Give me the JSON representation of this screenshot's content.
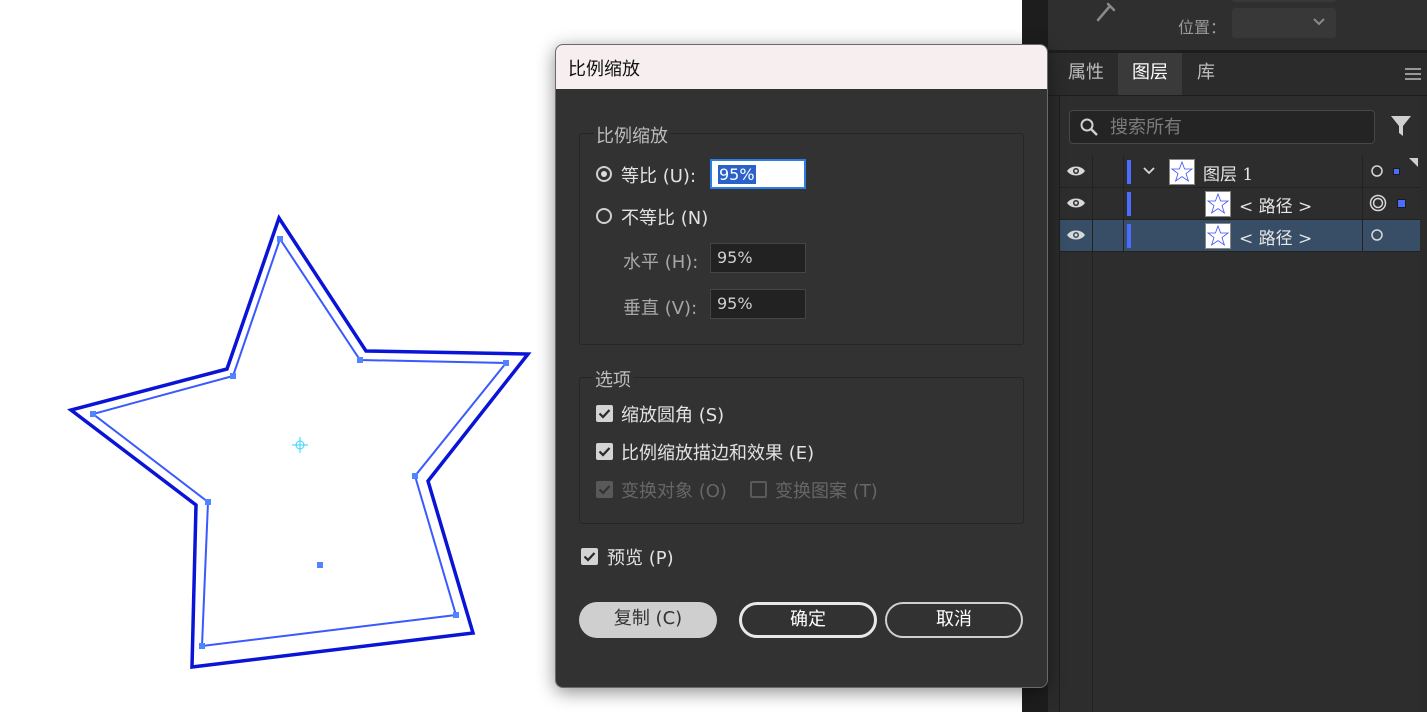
{
  "dialog": {
    "title": "比例缩放",
    "scale_group": {
      "label": "比例缩放",
      "uniform_label": "等比 (U):",
      "uniform_value": "95%",
      "uniform_selected": true,
      "nonuniform_label": "不等比 (N)",
      "horizontal_label": "水平 (H):",
      "horizontal_value": "95%",
      "vertical_label": "垂直 (V):",
      "vertical_value": "95%"
    },
    "options_group": {
      "label": "选项",
      "scale_corners_label": "缩放圆角 (S)",
      "scale_strokes_label": "比例缩放描边和效果 (E)",
      "transform_objects_label": "变换对象 (O)",
      "transform_patterns_label": "变换图案 (T)"
    },
    "preview_label": "预览 (P)",
    "copy_button": "复制 (C)",
    "ok_button": "确定",
    "cancel_button": "取消"
  },
  "panel": {
    "position_label": "位置：",
    "tabs": [
      "属性",
      "图层",
      "库"
    ],
    "active_tab": "图层",
    "search_placeholder": "搜索所有",
    "layers": [
      {
        "name": "图层 1",
        "level": 0,
        "expanded": true
      },
      {
        "name": "< 路径 >",
        "level": 1
      },
      {
        "name": "< 路径 >",
        "level": 1,
        "selected": true
      }
    ]
  },
  "colors": {
    "accent_blue": "#4a6dff",
    "star_stroke": "#0a14d6",
    "anchor": "#4f86ff",
    "center_mark": "#35d6ff",
    "selected_row": "#384e66"
  }
}
